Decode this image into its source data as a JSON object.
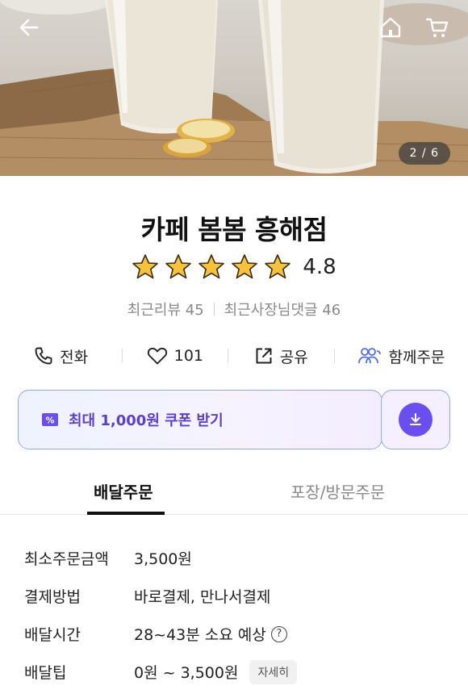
{
  "hero": {
    "page_indicator": "2 / 6",
    "icons": [
      "back-arrow-icon",
      "home-icon",
      "cart-icon"
    ]
  },
  "store": {
    "name": "카페 봄봄 흥해점",
    "rating": 4.8,
    "rating_text": "4.8",
    "star_count": 5,
    "star_color": "#f5c23a",
    "recent_reviews": "최근리뷰 45",
    "recent_owner_replies": "최근사장님댓글 46"
  },
  "actions": {
    "call": "전화",
    "likes": "101",
    "share": "공유",
    "group_order": "함께주문"
  },
  "coupon": {
    "label": "최대 1,000원 쿠폰 받기",
    "accent": "#6a4ef0"
  },
  "tabs": {
    "delivery": "배달주문",
    "pickup": "포장/방문주문",
    "active": "delivery"
  },
  "info": {
    "min_order_label": "최소주문금액",
    "min_order_value": "3,500원",
    "payment_label": "결제방법",
    "payment_value": "바로결제, 만나서결제",
    "delivery_time_label": "배달시간",
    "delivery_time_value": "28~43분 소요 예상",
    "delivery_tip_label": "배달팁",
    "delivery_tip_value": "0원 ~ 3,500원",
    "detail_button": "자세히"
  }
}
